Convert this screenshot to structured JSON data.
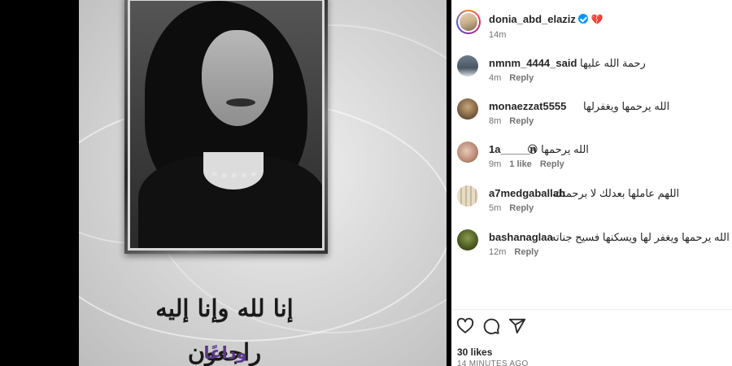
{
  "post_image": {
    "calligraphy": "إنا لله وإنا إليه راجعون",
    "farewell_text": "وداعًا"
  },
  "post": {
    "author": "donia_abd_elaziz",
    "verified": true,
    "heart_emoji": "💔",
    "time": "14m",
    "avatar_icon": "profile-avatar"
  },
  "comments": [
    {
      "username": "nmnm_4444_said",
      "text": "رحمة الله عليها",
      "time": "4m",
      "likes": "",
      "reply": "Reply"
    },
    {
      "username": "monaezzat5555",
      "text": "الله يرحمها ويغفرلها",
      "time": "8m",
      "likes": "",
      "reply": "Reply"
    },
    {
      "username": "1a_____n",
      "text": "الله يرحمها 😢",
      "time": "9m",
      "likes": "1 like",
      "reply": "Reply"
    },
    {
      "username": "a7medgaballah",
      "text": "اللهم عاملها بعدلك لا برحمتك",
      "time": "5m",
      "likes": "",
      "reply": "Reply"
    },
    {
      "username": "bashanaglaa",
      "text": "الله يرحمها ويغفر لها ويسكنها فسيح جناته",
      "time": "12m",
      "likes": "",
      "reply": "Reply"
    }
  ],
  "actions": {
    "like_icon": "heart-icon",
    "comment_icon": "comment-icon",
    "share_icon": "share-icon"
  },
  "likes_count": "30 likes",
  "time_ago": "14 MINUTES AGO",
  "colors": {
    "link_blue": "#0095f6",
    "text": "#262626",
    "muted": "#737373",
    "farewell_purple": "#5a3a86"
  }
}
